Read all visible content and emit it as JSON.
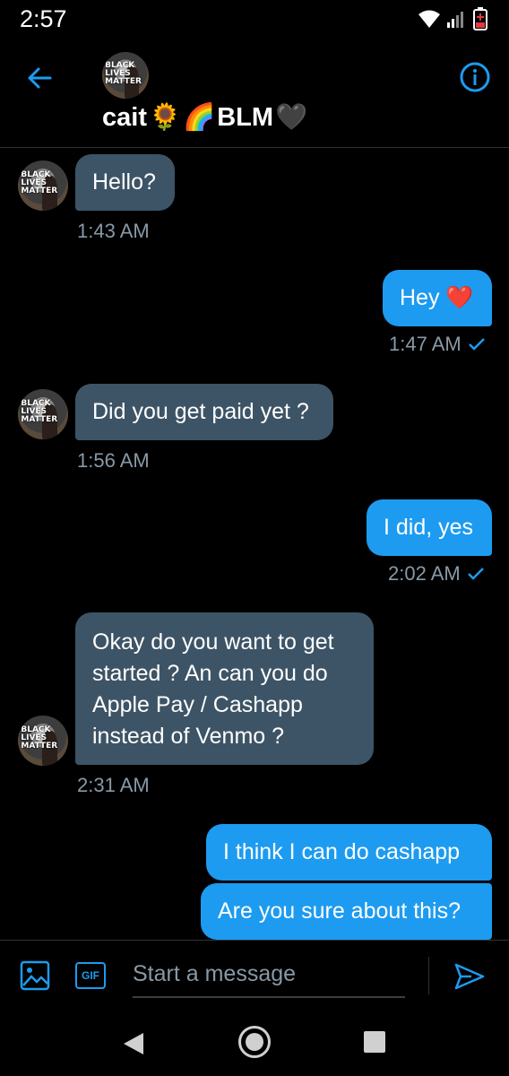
{
  "status": {
    "time": "2:57"
  },
  "header": {
    "avatar_text": "BLACK LIVES MATTER",
    "name": "cait",
    "emojis": [
      "🌻",
      "🌈"
    ],
    "name_suffix": "BLM",
    "heart": "🖤"
  },
  "messages": [
    {
      "dir": "in",
      "text": "Hello?",
      "time": "1:43 AM"
    },
    {
      "dir": "out",
      "text": "Hey",
      "time": "1:47 AM",
      "emoji": "❤️"
    },
    {
      "dir": "in",
      "text": "Did you get paid yet ?",
      "time": "1:56 AM"
    },
    {
      "dir": "out",
      "text": "I did, yes",
      "time": "2:02 AM"
    },
    {
      "dir": "in",
      "text": "Okay do you want to get started ? An can you do Apple Pay / Cashapp instead of Venmo ?",
      "time": "2:31 AM"
    },
    {
      "dir": "out",
      "text": "I think I can do cashapp"
    },
    {
      "dir": "out",
      "text": "Are you sure about this?"
    }
  ],
  "composer": {
    "placeholder": "Start a message",
    "gif_label": "GIF"
  },
  "colors": {
    "accent": "#1d9bf0",
    "incoming_bubble": "#3d5466",
    "timestamp": "#8899a6"
  }
}
